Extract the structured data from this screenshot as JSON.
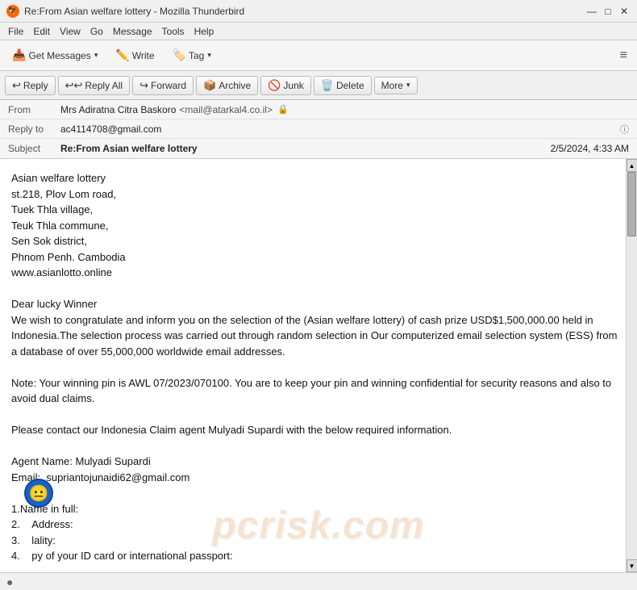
{
  "titleBar": {
    "icon": "🦅",
    "title": "Re:From Asian welfare lottery - Mozilla Thunderbird",
    "minimize": "—",
    "maximize": "□",
    "close": "✕"
  },
  "menuBar": {
    "items": [
      "File",
      "Edit",
      "View",
      "Go",
      "Message",
      "Tools",
      "Help"
    ]
  },
  "toolbar": {
    "getMessages": "Get Messages",
    "write": "Write",
    "tag": "Tag",
    "hamburger": "≡"
  },
  "emailToolbar": {
    "reply": "Reply",
    "replyAll": "Reply All",
    "forward": "Forward",
    "archive": "Archive",
    "junk": "Junk",
    "delete": "Delete",
    "more": "More"
  },
  "emailHeader": {
    "fromLabel": "From",
    "fromName": "Mrs Adiratna Citra Baskoro",
    "fromEmail": "<mail@atarkal4.co.il>",
    "replyToLabel": "Reply to",
    "replyToValue": "ac4114708@gmail.com",
    "subjectLabel": "Subject",
    "subjectValue": "Re:From Asian welfare lottery",
    "dateValue": "2/5/2024, 4:33 AM"
  },
  "emailBody": {
    "lines": [
      "Asian welfare lottery",
      "st.218, Plov Lom road,",
      "Tuek Thla village,",
      "Teuk Thla commune,",
      "Sen Sok district,",
      "Phnom Penh. Cambodia",
      "www.asianlotto.online",
      "",
      "Dear lucky Winner",
      "We wish to congratulate and inform you on the selection of the (Asian welfare lottery) of cash prize USD$1,500,000.00 held in Indonesia.The selection process was carried out through random selection in Our computerized email selection system (ESS) from a database of over 55,000,000 worldwide email addresses.",
      "",
      "Note: Your winning pin is AWL 07/2023/070100. You are to keep your pin and winning confidential for security reasons and also to avoid dual claims.",
      "",
      "Please contact our Indonesia Claim agent Mulyadi Supardi with the below required information.",
      "",
      "Agent Name: Mulyadi Supardi",
      "Email:  supriantojunaidi62@gmail.com",
      "",
      "1.Name in full:",
      "2.    Address:",
      "3.    lality:",
      "4.    py of your ID card or international passport:"
    ]
  },
  "watermark": {
    "text": "pcrisk.com"
  },
  "statusBar": {
    "icon": "●"
  }
}
